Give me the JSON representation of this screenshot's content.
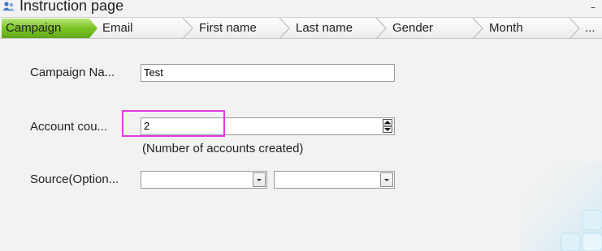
{
  "window": {
    "title": "Instruction page",
    "minimize_label": "–"
  },
  "steps": [
    {
      "label": "Campaign",
      "active": true
    },
    {
      "label": "Email",
      "active": false
    },
    {
      "label": "First name",
      "active": false
    },
    {
      "label": "Last name",
      "active": false
    },
    {
      "label": "Gender",
      "active": false
    },
    {
      "label": "Month",
      "active": false
    },
    {
      "label": "...",
      "active": false
    }
  ],
  "form": {
    "campaign_name_label": "Campaign  Na...",
    "campaign_name_value": "Test",
    "account_count_label": "Account cou...",
    "account_count_value": "2",
    "account_count_hint": "(Number of accounts created)",
    "source_label": "Source(Option...",
    "source_value_1": "",
    "source_value_2": ""
  },
  "colors": {
    "active_step": "#7cc425",
    "highlight": "#e23ae0",
    "deco_tiles": "#cfeaf5"
  },
  "icons": {
    "title": "users-icon",
    "minimize": "minimize-icon",
    "step_separator": "chevron-right-icon",
    "spin_up": "triangle-up-icon",
    "spin_down": "triangle-down-icon",
    "combo_arrow": "triangle-down-icon"
  }
}
